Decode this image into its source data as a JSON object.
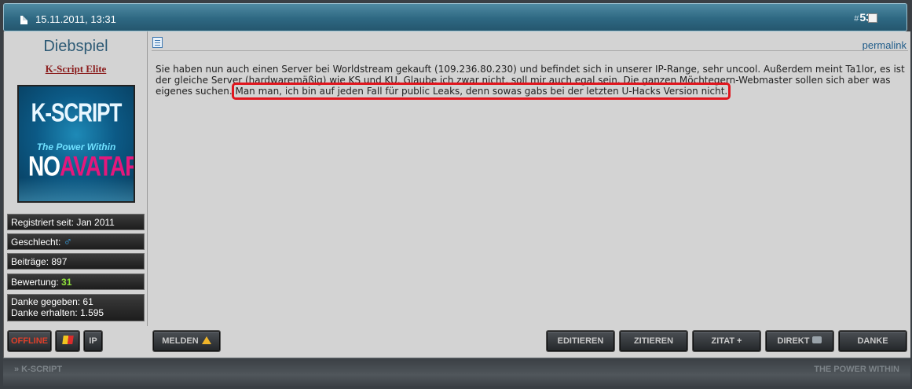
{
  "header": {
    "date": "15.11.2011, 13:31",
    "post_hash": "#",
    "post_number": "53"
  },
  "user": {
    "name": "Diebspiel",
    "title": "K-Script Elite",
    "avatar": {
      "brand": "K-SCRIPT",
      "slogan": "The Power Within",
      "no": "NO",
      "avatar_word": "AVATAR"
    },
    "stats": {
      "registered": "Registriert seit: Jan 2011",
      "gender_label": "Geschlecht:",
      "gender_symbol": "♂",
      "posts": "Beiträge: 897",
      "rating_label": "Bewertung:",
      "rating_value": "31",
      "thanks_given": "Danke gegeben: 61",
      "thanks_received": "Danke erhalten: 1.595"
    }
  },
  "post": {
    "permalink": "permalink",
    "text_part1": "Sie haben nun auch einen Server bei Worldstream gekauft (109.236.80.230) und befindet sich in unserer IP-Range, sehr uncool. Außerdem meint Ta1lor, es ist der gleiche Server (hardwaremäßig) wie KS und KU. Glaube ich zwar nicht, soll mir auch egal sein. Die ganzen Möchtegern-Webmaster sollen sich aber was eigenes suchen.",
    "text_highlight": "Man man, ich bin auf jeden Fall für public Leaks, denn sowas gabs bei der letzten U-Hacks Version nicht."
  },
  "buttons": {
    "offline": "OFFLINE",
    "ip": "IP",
    "melden": "MELDEN",
    "editieren": "EDITIEREN",
    "zitieren": "ZITIEREN",
    "zitat": "ZITAT",
    "zitat_plus": "+",
    "direkt": "DIREKT",
    "danke": "DANKE"
  },
  "footer": {
    "left": "» K-SCRIPT",
    "right": "THE POWER WITHIN"
  },
  "colors": {
    "header_blue": "#2e6882",
    "highlight_red": "#e0161e",
    "username_blue": "#2d5a75",
    "usertitle_red": "#8a1c1c",
    "rating_green": "#8fe23a"
  },
  "icons": {
    "header": "document-icon",
    "checkbox": "select-checkbox",
    "post": "post-icon",
    "report": "warning-icon",
    "message": "chat-bubble-icon",
    "flag": "flag-icon",
    "gender": "male-icon"
  }
}
